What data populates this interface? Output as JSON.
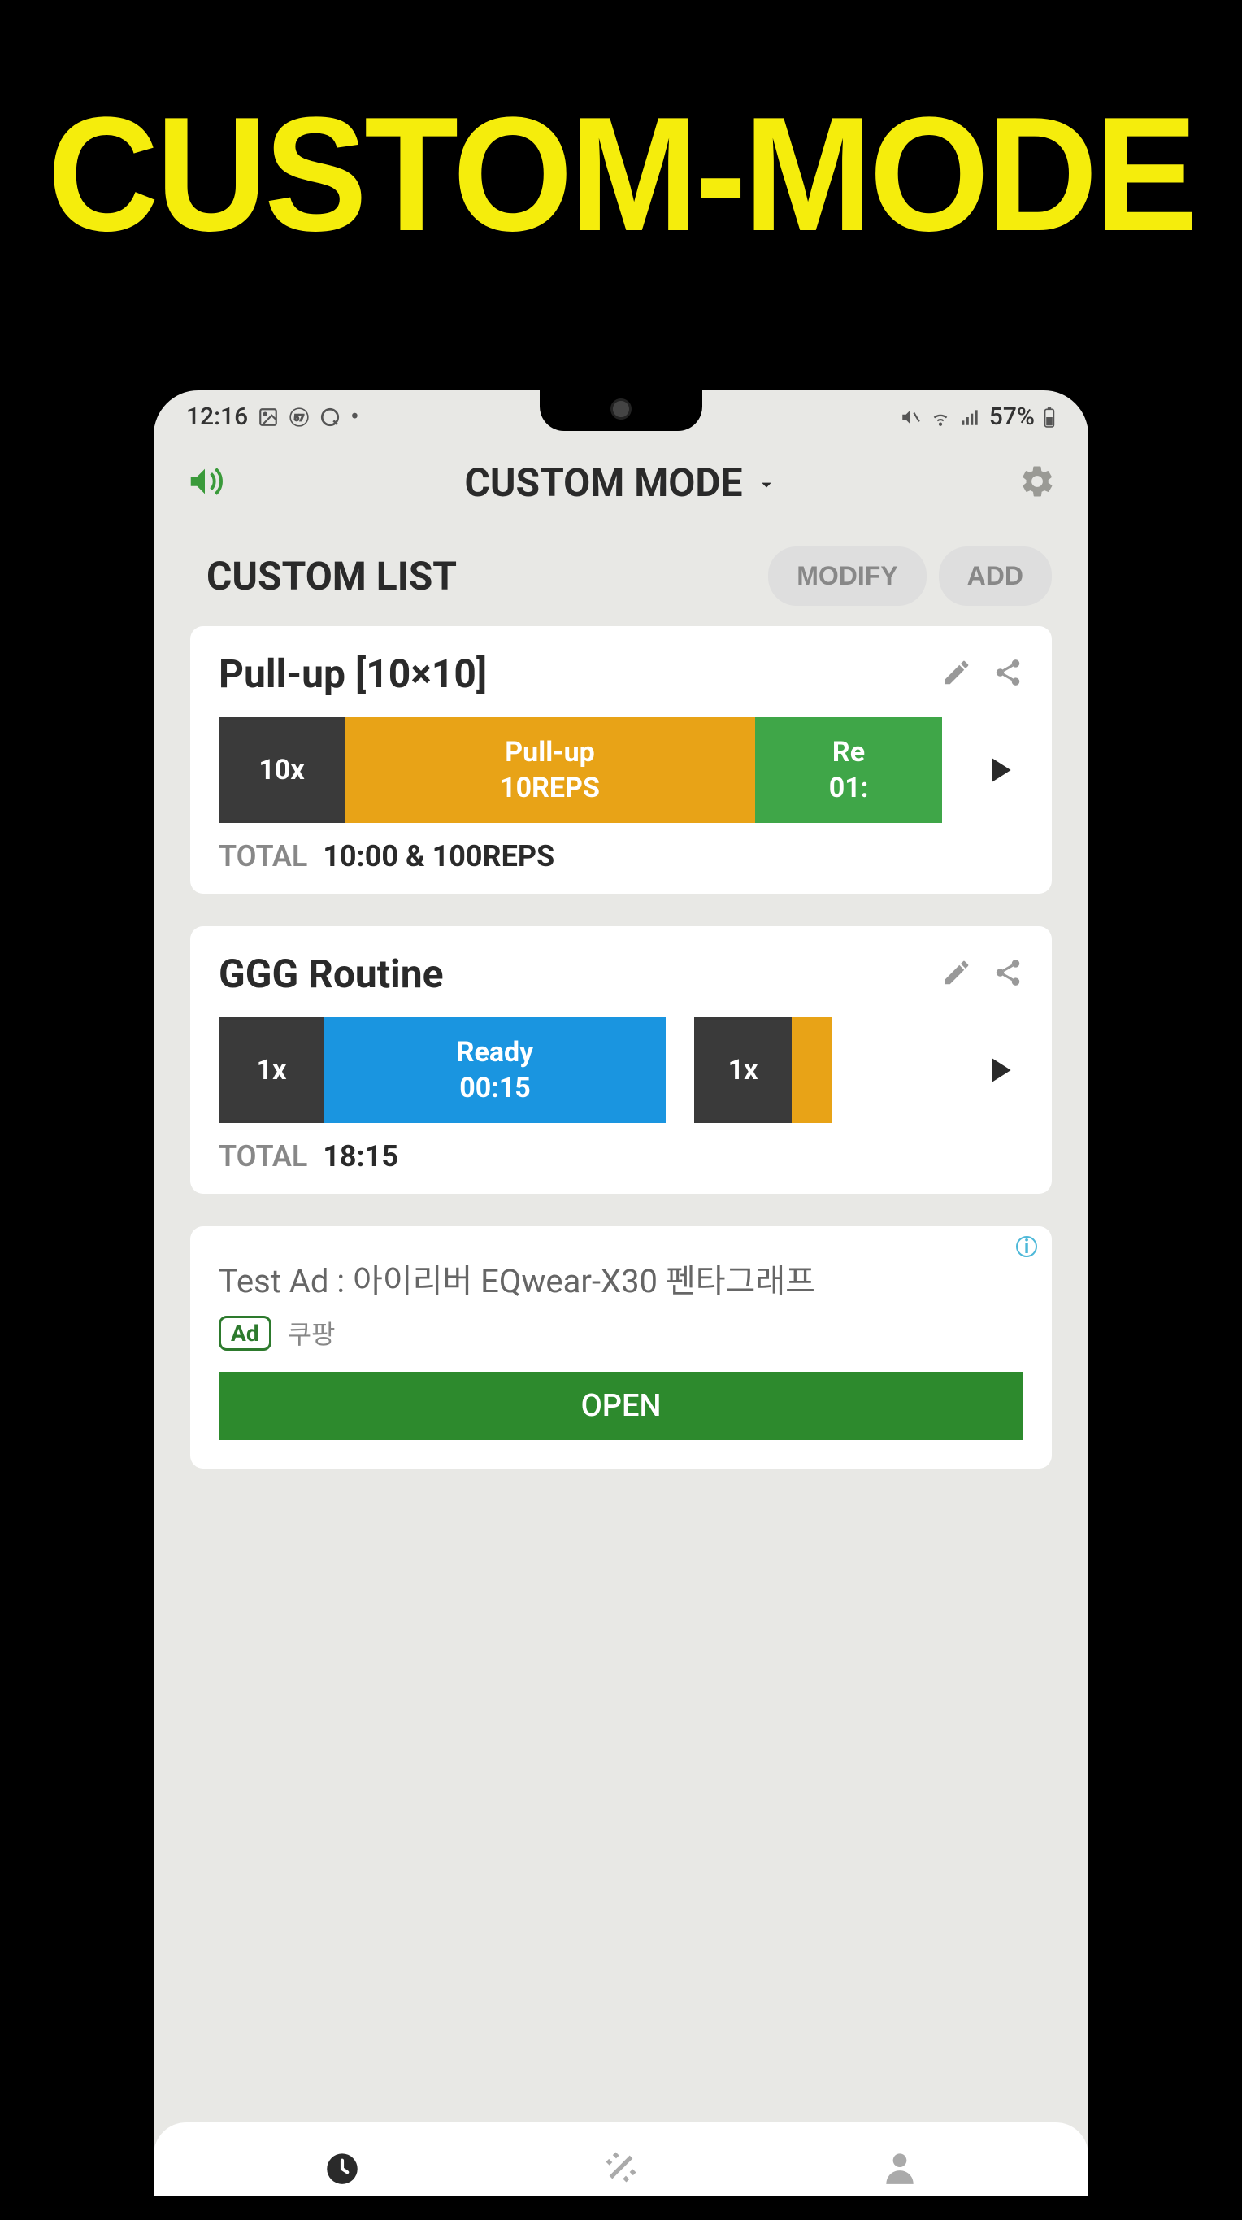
{
  "promo": {
    "title": "CUSTOM-MODE"
  },
  "status": {
    "time": "12:16",
    "battery": "57%"
  },
  "header": {
    "title": "CUSTOM MODE"
  },
  "list": {
    "title": "CUSTOM LIST",
    "modify_label": "MODIFY",
    "add_label": "ADD"
  },
  "workouts": [
    {
      "title": "Pull-up [10×10]",
      "blocks": [
        {
          "count": "10x"
        },
        {
          "name": "Pull-up",
          "detail": "10REPS"
        },
        {
          "name": "Re",
          "detail": "01:"
        }
      ],
      "total_label": "TOTAL",
      "total_value": "10:00 & 100REPS"
    },
    {
      "title": "GGG Routine",
      "blocks": [
        {
          "count": "1x"
        },
        {
          "name": "Ready",
          "detail": "00:15"
        },
        {
          "count": "1x"
        }
      ],
      "total_label": "TOTAL",
      "total_value": "18:15"
    }
  ],
  "ad": {
    "title": "Test Ad : 아이리버 EQwear-X30 펜타그래프",
    "badge": "Ad",
    "source": "쿠팡",
    "button": "OPEN"
  }
}
